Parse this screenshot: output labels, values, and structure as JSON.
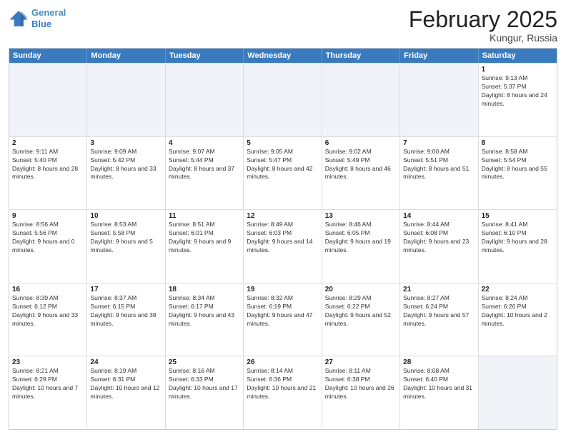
{
  "header": {
    "logo_line1": "General",
    "logo_line2": "Blue",
    "month": "February 2025",
    "location": "Kungur, Russia"
  },
  "days_of_week": [
    "Sunday",
    "Monday",
    "Tuesday",
    "Wednesday",
    "Thursday",
    "Friday",
    "Saturday"
  ],
  "weeks": [
    [
      {
        "day": "",
        "info": "",
        "shade": true
      },
      {
        "day": "",
        "info": "",
        "shade": true
      },
      {
        "day": "",
        "info": "",
        "shade": true
      },
      {
        "day": "",
        "info": "",
        "shade": true
      },
      {
        "day": "",
        "info": "",
        "shade": true
      },
      {
        "day": "",
        "info": "",
        "shade": true
      },
      {
        "day": "1",
        "info": "Sunrise: 9:13 AM\nSunset: 5:37 PM\nDaylight: 8 hours and 24 minutes.",
        "shade": false
      }
    ],
    [
      {
        "day": "2",
        "info": "Sunrise: 9:11 AM\nSunset: 5:40 PM\nDaylight: 8 hours and 28 minutes.",
        "shade": false
      },
      {
        "day": "3",
        "info": "Sunrise: 9:09 AM\nSunset: 5:42 PM\nDaylight: 8 hours and 33 minutes.",
        "shade": false
      },
      {
        "day": "4",
        "info": "Sunrise: 9:07 AM\nSunset: 5:44 PM\nDaylight: 8 hours and 37 minutes.",
        "shade": false
      },
      {
        "day": "5",
        "info": "Sunrise: 9:05 AM\nSunset: 5:47 PM\nDaylight: 8 hours and 42 minutes.",
        "shade": false
      },
      {
        "day": "6",
        "info": "Sunrise: 9:02 AM\nSunset: 5:49 PM\nDaylight: 8 hours and 46 minutes.",
        "shade": false
      },
      {
        "day": "7",
        "info": "Sunrise: 9:00 AM\nSunset: 5:51 PM\nDaylight: 8 hours and 51 minutes.",
        "shade": false
      },
      {
        "day": "8",
        "info": "Sunrise: 8:58 AM\nSunset: 5:54 PM\nDaylight: 8 hours and 55 minutes.",
        "shade": false
      }
    ],
    [
      {
        "day": "9",
        "info": "Sunrise: 8:56 AM\nSunset: 5:56 PM\nDaylight: 9 hours and 0 minutes.",
        "shade": false
      },
      {
        "day": "10",
        "info": "Sunrise: 8:53 AM\nSunset: 5:58 PM\nDaylight: 9 hours and 5 minutes.",
        "shade": false
      },
      {
        "day": "11",
        "info": "Sunrise: 8:51 AM\nSunset: 6:01 PM\nDaylight: 9 hours and 9 minutes.",
        "shade": false
      },
      {
        "day": "12",
        "info": "Sunrise: 8:49 AM\nSunset: 6:03 PM\nDaylight: 9 hours and 14 minutes.",
        "shade": false
      },
      {
        "day": "13",
        "info": "Sunrise: 8:46 AM\nSunset: 6:05 PM\nDaylight: 9 hours and 19 minutes.",
        "shade": false
      },
      {
        "day": "14",
        "info": "Sunrise: 8:44 AM\nSunset: 6:08 PM\nDaylight: 9 hours and 23 minutes.",
        "shade": false
      },
      {
        "day": "15",
        "info": "Sunrise: 8:41 AM\nSunset: 6:10 PM\nDaylight: 9 hours and 28 minutes.",
        "shade": false
      }
    ],
    [
      {
        "day": "16",
        "info": "Sunrise: 8:39 AM\nSunset: 6:12 PM\nDaylight: 9 hours and 33 minutes.",
        "shade": false
      },
      {
        "day": "17",
        "info": "Sunrise: 8:37 AM\nSunset: 6:15 PM\nDaylight: 9 hours and 38 minutes.",
        "shade": false
      },
      {
        "day": "18",
        "info": "Sunrise: 8:34 AM\nSunset: 6:17 PM\nDaylight: 9 hours and 43 minutes.",
        "shade": false
      },
      {
        "day": "19",
        "info": "Sunrise: 8:32 AM\nSunset: 6:19 PM\nDaylight: 9 hours and 47 minutes.",
        "shade": false
      },
      {
        "day": "20",
        "info": "Sunrise: 8:29 AM\nSunset: 6:22 PM\nDaylight: 9 hours and 52 minutes.",
        "shade": false
      },
      {
        "day": "21",
        "info": "Sunrise: 8:27 AM\nSunset: 6:24 PM\nDaylight: 9 hours and 57 minutes.",
        "shade": false
      },
      {
        "day": "22",
        "info": "Sunrise: 8:24 AM\nSunset: 6:26 PM\nDaylight: 10 hours and 2 minutes.",
        "shade": false
      }
    ],
    [
      {
        "day": "23",
        "info": "Sunrise: 8:21 AM\nSunset: 6:29 PM\nDaylight: 10 hours and 7 minutes.",
        "shade": false
      },
      {
        "day": "24",
        "info": "Sunrise: 8:19 AM\nSunset: 6:31 PM\nDaylight: 10 hours and 12 minutes.",
        "shade": false
      },
      {
        "day": "25",
        "info": "Sunrise: 8:16 AM\nSunset: 6:33 PM\nDaylight: 10 hours and 17 minutes.",
        "shade": false
      },
      {
        "day": "26",
        "info": "Sunrise: 8:14 AM\nSunset: 6:36 PM\nDaylight: 10 hours and 21 minutes.",
        "shade": false
      },
      {
        "day": "27",
        "info": "Sunrise: 8:11 AM\nSunset: 6:38 PM\nDaylight: 10 hours and 26 minutes.",
        "shade": false
      },
      {
        "day": "28",
        "info": "Sunrise: 8:08 AM\nSunset: 6:40 PM\nDaylight: 10 hours and 31 minutes.",
        "shade": false
      },
      {
        "day": "",
        "info": "",
        "shade": true
      }
    ]
  ]
}
